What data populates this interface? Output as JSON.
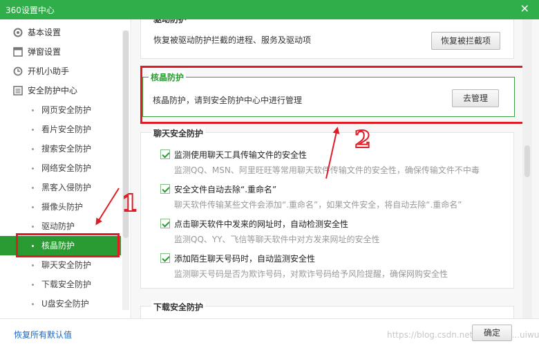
{
  "window": {
    "title": "360设置中心",
    "close_glyph": "✕"
  },
  "sidebar": {
    "top_items": [
      {
        "label": "基本设置",
        "icon": "gear-icon"
      },
      {
        "label": "弹窗设置",
        "icon": "window-icon"
      },
      {
        "label": "开机小助手",
        "icon": "clock-icon"
      },
      {
        "label": "安全防护中心",
        "icon": "list-icon"
      }
    ],
    "sub_items": [
      {
        "label": "网页安全防护"
      },
      {
        "label": "看片安全防护"
      },
      {
        "label": "搜索安全防护"
      },
      {
        "label": "网络安全防护"
      },
      {
        "label": "黑客入侵防护"
      },
      {
        "label": "摄像头防护"
      },
      {
        "label": "驱动防护"
      },
      {
        "label": "核晶防护",
        "active": true
      },
      {
        "label": "聊天安全防护"
      },
      {
        "label": "下载安全防护"
      },
      {
        "label": "U盘安全防护"
      }
    ]
  },
  "content": {
    "driver": {
      "title": "驱动防护",
      "desc": "恢复被驱动防护拦截的进程、服务及驱动项",
      "button": "恢复被拦截项"
    },
    "hexin": {
      "title": "核晶防护",
      "desc": "核晶防护，请到安全防护中心中进行管理",
      "button": "去管理"
    },
    "chat": {
      "title": "聊天安全防护",
      "options": [
        {
          "label": "监测使用聊天工具传输文件的安全性",
          "desc": "监测QQ、MSN、阿里旺旺等常用聊天软件传输文件的安全性，确保传输文件不中毒",
          "checked": true
        },
        {
          "label": "安全文件自动去除“.重命名”",
          "desc": "聊天软件传输某些文件会添加“.重命名”，如果文件安全，将自动去除“.重命名”",
          "checked": true
        },
        {
          "label": "点击聊天软件中发来的网址时，自动检测安全性",
          "desc": "监测QQ、YY、飞信等聊天软件中对方发来网址的安全性",
          "checked": true
        },
        {
          "label": "添加陌生聊天号码时，自动监测安全性",
          "desc": "监测聊天号码是否为欺诈号码，对欺诈号码给予风险提醒，确保网购安全性",
          "checked": true
        }
      ]
    },
    "download": {
      "title": "下载安全防护"
    }
  },
  "footer": {
    "restore_link": "恢复所有默认值",
    "ok_button": "确定",
    "watermark": "https://blog.csdn.net/weixin_4...uiwu"
  },
  "annotations": {
    "label_1": "1",
    "label_2": "2",
    "color": "#e01b24"
  },
  "colors": {
    "brand_green": "#2fae4a",
    "active_green": "#2a9b32",
    "link_blue": "#1a66c4"
  }
}
